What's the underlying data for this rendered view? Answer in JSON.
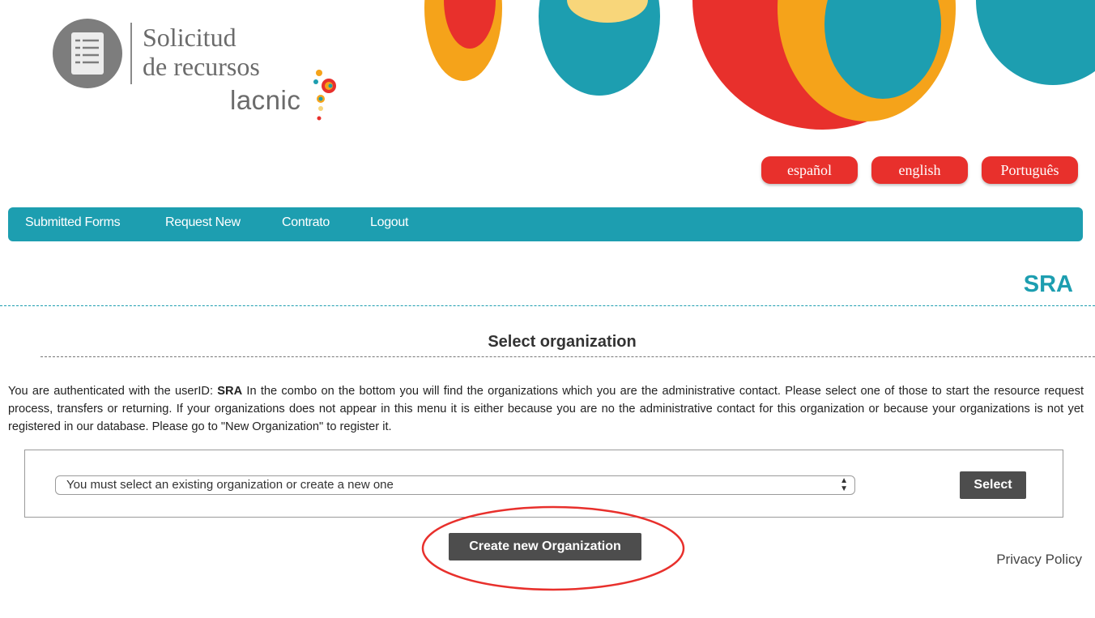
{
  "header": {
    "logo_line1": "Solicitud",
    "logo_line2": "de recursos",
    "brand": "lacnic",
    "colors": {
      "red": "#e8302c",
      "teal": "#1d9eb0",
      "orange": "#f5a31a",
      "yellow": "#f8d67a",
      "gray": "#6b6b6b"
    }
  },
  "languages": [
    {
      "label": "español"
    },
    {
      "label": "english"
    },
    {
      "label": "Português"
    }
  ],
  "nav": {
    "items": [
      {
        "label": "Submitted Forms"
      },
      {
        "label": "Request New"
      },
      {
        "label": "Contrato"
      },
      {
        "label": "Logout"
      }
    ]
  },
  "page": {
    "title": "SRA",
    "section_title": "Select organization",
    "intro_prefix": "You are authenticated with the userID:",
    "user_id": "SRA",
    "intro_text": "In the combo on the bottom you will find the organizations which you are the administrative contact. Please select one of those to start the resource request process, transfers or returning. If your organizations does not appear in this menu it is either because you are no the administrative contact for this organization or because your organizations is not yet registered in our database. Please go to \"New Organization\" to register it."
  },
  "org_form": {
    "select_value": "You must select an existing organization or create a new one",
    "select_button": "Select",
    "create_button": "Create new Organization"
  },
  "footer": {
    "privacy": "Privacy Policy"
  }
}
